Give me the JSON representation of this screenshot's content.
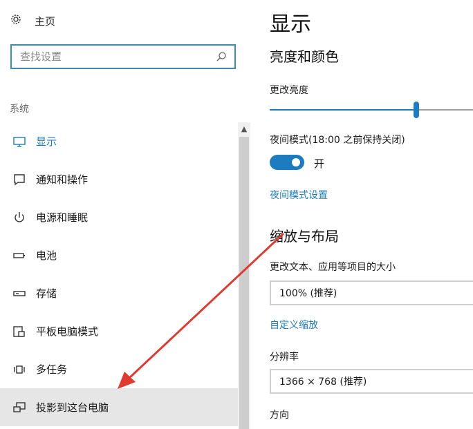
{
  "nav": {
    "home_label": "主页",
    "search_placeholder": "查找设置",
    "section_label": "系统",
    "items": [
      {
        "label": "显示",
        "icon": "monitor-icon"
      },
      {
        "label": "通知和操作",
        "icon": "notification-icon"
      },
      {
        "label": "电源和睡眠",
        "icon": "power-icon"
      },
      {
        "label": "电池",
        "icon": "battery-icon"
      },
      {
        "label": "存储",
        "icon": "storage-icon"
      },
      {
        "label": "平板电脑模式",
        "icon": "tablet-mode-icon"
      },
      {
        "label": "多任务",
        "icon": "multitask-icon"
      },
      {
        "label": "投影到这台电脑",
        "icon": "project-icon"
      }
    ]
  },
  "content": {
    "title": "显示",
    "color_section": "亮度和颜色",
    "brightness_label": "更改亮度",
    "brightness_value": 0.72,
    "night_mode_label": "夜间模式(18:00 之前保持关闭)",
    "night_mode_state": "开",
    "night_mode_link": "夜间模式设置",
    "scale_section": "缩放与布局",
    "scale_label": "更改文本、应用等项目的大小",
    "scale_value": "100% (推荐)",
    "custom_scale_link": "自定义缩放",
    "resolution_label": "分辨率",
    "resolution_value": "1366 × 768 (推荐)",
    "orientation_label": "方向"
  },
  "colors": {
    "accent": "#1d7bbf",
    "search_border": "#3d8ca9",
    "annotation_arrow": "#e03a30"
  }
}
